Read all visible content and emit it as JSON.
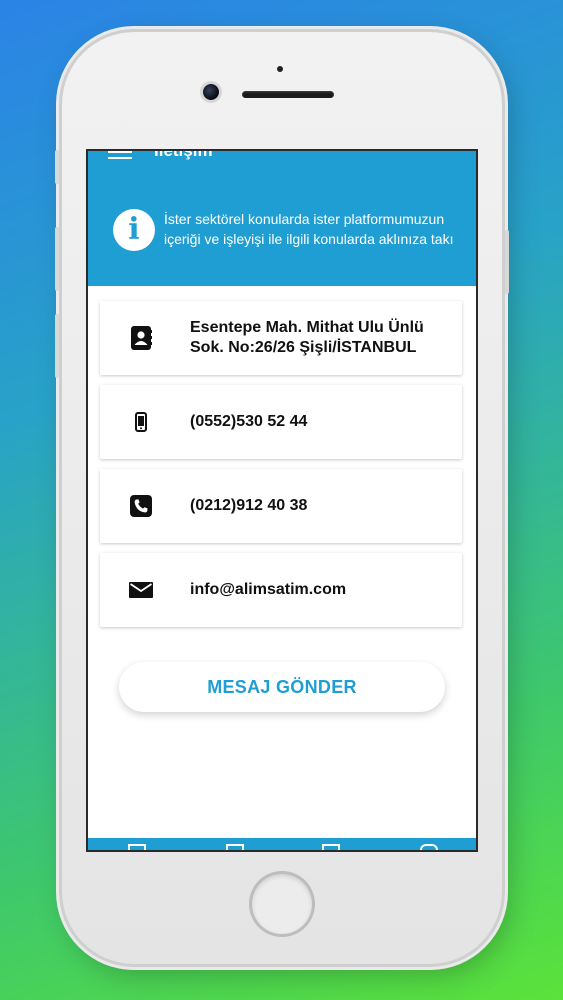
{
  "appbar": {
    "title": "İletişim"
  },
  "info": {
    "line1": "İster sektörel konularda ister platformumuzun",
    "line2": "içeriği ve işleyişi ile ilgili konularda aklınıza takı"
  },
  "contacts": [
    {
      "icon": "address-book-icon",
      "line1": "Esentepe Mah. Mithat Ulu Ünlü",
      "line2": "Sok. No:26/26 Şişli/İSTANBUL"
    },
    {
      "icon": "mobile-phone-icon",
      "line1": "(0552)530 52 44",
      "line2": ""
    },
    {
      "icon": "phone-icon",
      "line1": "(0212)912 40 38",
      "line2": ""
    },
    {
      "icon": "envelope-icon",
      "line1": "info@alimsatim.com",
      "line2": ""
    }
  ],
  "send_button": {
    "label": "MESAJ GÖNDER"
  },
  "colors": {
    "accent": "#1f9ed3",
    "background_top": "#2a83e6",
    "background_bottom": "#5be23a"
  }
}
